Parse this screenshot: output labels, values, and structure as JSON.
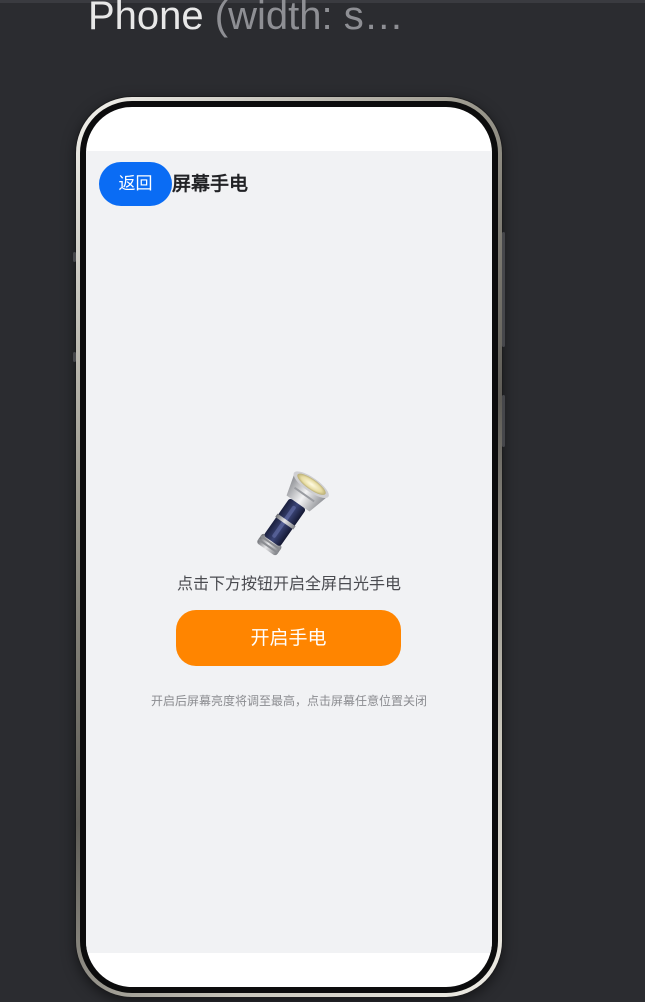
{
  "preview": {
    "device": "Phone",
    "subtitle": "(width: s…"
  },
  "app": {
    "back_label": "返回",
    "title": "屏幕手电",
    "hint": "点击下方按钮开启全屏白光手电",
    "start_label": "开启手电",
    "note": "开启后屏幕亮度将调至最高，点击屏幕任意位置关闭"
  },
  "colors": {
    "back_button": "#0a6cf4",
    "start_button": "#ff8500",
    "app_background": "#f1f2f4",
    "window_background": "#2b2c30"
  },
  "icons": {
    "main": "flashlight-icon"
  }
}
